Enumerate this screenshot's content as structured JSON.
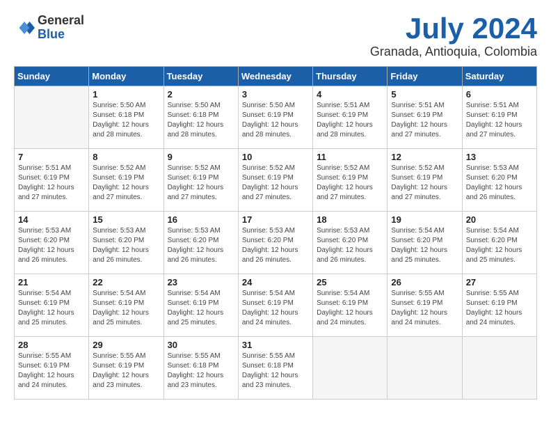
{
  "header": {
    "logo_general": "General",
    "logo_blue": "Blue",
    "month_title": "July 2024",
    "location": "Granada, Antioquia, Colombia"
  },
  "weekdays": [
    "Sunday",
    "Monday",
    "Tuesday",
    "Wednesday",
    "Thursday",
    "Friday",
    "Saturday"
  ],
  "weeks": [
    [
      {
        "day": "",
        "info": ""
      },
      {
        "day": "1",
        "info": "Sunrise: 5:50 AM\nSunset: 6:18 PM\nDaylight: 12 hours\nand 28 minutes."
      },
      {
        "day": "2",
        "info": "Sunrise: 5:50 AM\nSunset: 6:18 PM\nDaylight: 12 hours\nand 28 minutes."
      },
      {
        "day": "3",
        "info": "Sunrise: 5:50 AM\nSunset: 6:19 PM\nDaylight: 12 hours\nand 28 minutes."
      },
      {
        "day": "4",
        "info": "Sunrise: 5:51 AM\nSunset: 6:19 PM\nDaylight: 12 hours\nand 28 minutes."
      },
      {
        "day": "5",
        "info": "Sunrise: 5:51 AM\nSunset: 6:19 PM\nDaylight: 12 hours\nand 27 minutes."
      },
      {
        "day": "6",
        "info": "Sunrise: 5:51 AM\nSunset: 6:19 PM\nDaylight: 12 hours\nand 27 minutes."
      }
    ],
    [
      {
        "day": "7",
        "info": "Sunrise: 5:51 AM\nSunset: 6:19 PM\nDaylight: 12 hours\nand 27 minutes."
      },
      {
        "day": "8",
        "info": "Sunrise: 5:52 AM\nSunset: 6:19 PM\nDaylight: 12 hours\nand 27 minutes."
      },
      {
        "day": "9",
        "info": "Sunrise: 5:52 AM\nSunset: 6:19 PM\nDaylight: 12 hours\nand 27 minutes."
      },
      {
        "day": "10",
        "info": "Sunrise: 5:52 AM\nSunset: 6:19 PM\nDaylight: 12 hours\nand 27 minutes."
      },
      {
        "day": "11",
        "info": "Sunrise: 5:52 AM\nSunset: 6:19 PM\nDaylight: 12 hours\nand 27 minutes."
      },
      {
        "day": "12",
        "info": "Sunrise: 5:52 AM\nSunset: 6:19 PM\nDaylight: 12 hours\nand 27 minutes."
      },
      {
        "day": "13",
        "info": "Sunrise: 5:53 AM\nSunset: 6:20 PM\nDaylight: 12 hours\nand 26 minutes."
      }
    ],
    [
      {
        "day": "14",
        "info": "Sunrise: 5:53 AM\nSunset: 6:20 PM\nDaylight: 12 hours\nand 26 minutes."
      },
      {
        "day": "15",
        "info": "Sunrise: 5:53 AM\nSunset: 6:20 PM\nDaylight: 12 hours\nand 26 minutes."
      },
      {
        "day": "16",
        "info": "Sunrise: 5:53 AM\nSunset: 6:20 PM\nDaylight: 12 hours\nand 26 minutes."
      },
      {
        "day": "17",
        "info": "Sunrise: 5:53 AM\nSunset: 6:20 PM\nDaylight: 12 hours\nand 26 minutes."
      },
      {
        "day": "18",
        "info": "Sunrise: 5:53 AM\nSunset: 6:20 PM\nDaylight: 12 hours\nand 26 minutes."
      },
      {
        "day": "19",
        "info": "Sunrise: 5:54 AM\nSunset: 6:20 PM\nDaylight: 12 hours\nand 25 minutes."
      },
      {
        "day": "20",
        "info": "Sunrise: 5:54 AM\nSunset: 6:20 PM\nDaylight: 12 hours\nand 25 minutes."
      }
    ],
    [
      {
        "day": "21",
        "info": "Sunrise: 5:54 AM\nSunset: 6:19 PM\nDaylight: 12 hours\nand 25 minutes."
      },
      {
        "day": "22",
        "info": "Sunrise: 5:54 AM\nSunset: 6:19 PM\nDaylight: 12 hours\nand 25 minutes."
      },
      {
        "day": "23",
        "info": "Sunrise: 5:54 AM\nSunset: 6:19 PM\nDaylight: 12 hours\nand 25 minutes."
      },
      {
        "day": "24",
        "info": "Sunrise: 5:54 AM\nSunset: 6:19 PM\nDaylight: 12 hours\nand 24 minutes."
      },
      {
        "day": "25",
        "info": "Sunrise: 5:54 AM\nSunset: 6:19 PM\nDaylight: 12 hours\nand 24 minutes."
      },
      {
        "day": "26",
        "info": "Sunrise: 5:55 AM\nSunset: 6:19 PM\nDaylight: 12 hours\nand 24 minutes."
      },
      {
        "day": "27",
        "info": "Sunrise: 5:55 AM\nSunset: 6:19 PM\nDaylight: 12 hours\nand 24 minutes."
      }
    ],
    [
      {
        "day": "28",
        "info": "Sunrise: 5:55 AM\nSunset: 6:19 PM\nDaylight: 12 hours\nand 24 minutes."
      },
      {
        "day": "29",
        "info": "Sunrise: 5:55 AM\nSunset: 6:19 PM\nDaylight: 12 hours\nand 23 minutes."
      },
      {
        "day": "30",
        "info": "Sunrise: 5:55 AM\nSunset: 6:18 PM\nDaylight: 12 hours\nand 23 minutes."
      },
      {
        "day": "31",
        "info": "Sunrise: 5:55 AM\nSunset: 6:18 PM\nDaylight: 12 hours\nand 23 minutes."
      },
      {
        "day": "",
        "info": ""
      },
      {
        "day": "",
        "info": ""
      },
      {
        "day": "",
        "info": ""
      }
    ]
  ]
}
